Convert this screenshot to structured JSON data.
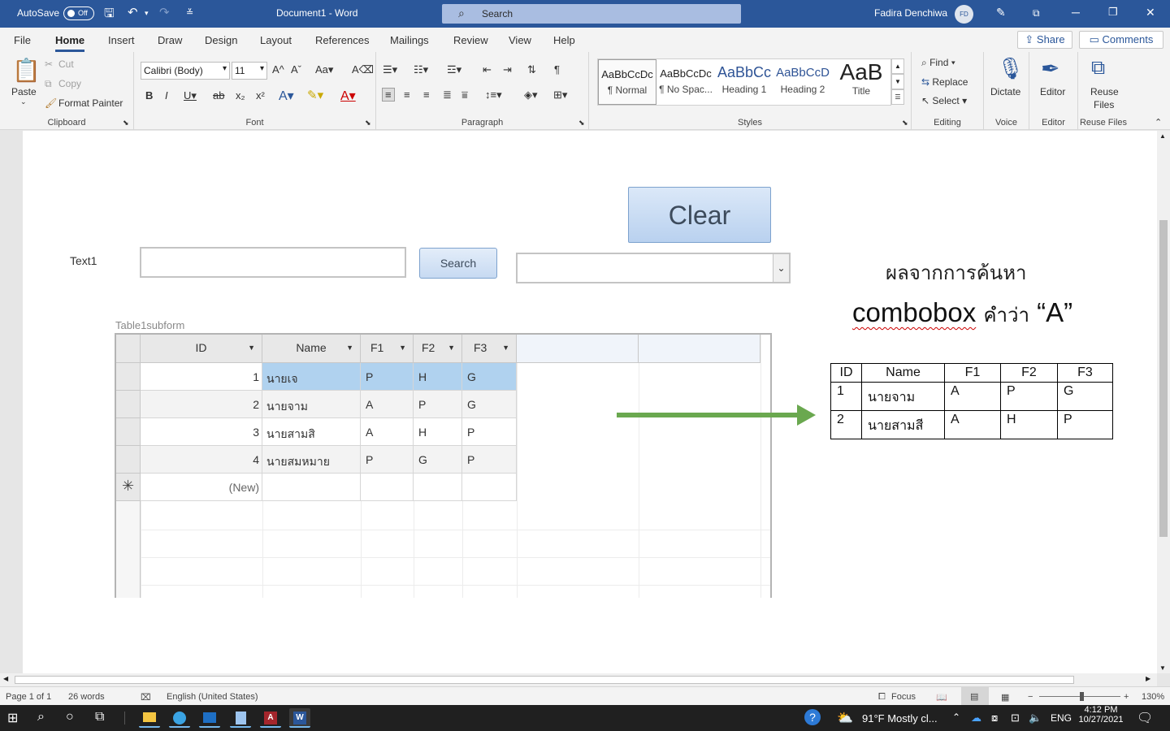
{
  "titlebar": {
    "autosave_label": "AutoSave",
    "autosave_state": "Off",
    "doc_title": "Document1  -  Word",
    "search_placeholder": "Search",
    "user_name": "Fadira Denchiwa",
    "user_initials": "FD"
  },
  "menu": {
    "tabs": [
      "File",
      "Home",
      "Insert",
      "Draw",
      "Design",
      "Layout",
      "References",
      "Mailings",
      "Review",
      "View",
      "Help"
    ],
    "active_tab": "Home",
    "share_label": "Share",
    "comments_label": "Comments"
  },
  "ribbon": {
    "clipboard": {
      "label": "Clipboard",
      "paste": "Paste",
      "cut": "Cut",
      "copy": "Copy",
      "format_painter": "Format Painter"
    },
    "font": {
      "label": "Font",
      "font_name": "Calibri (Body)",
      "font_size": "11"
    },
    "paragraph": {
      "label": "Paragraph"
    },
    "styles": {
      "label": "Styles",
      "items": [
        {
          "preview": "AaBbCcDc",
          "name": "¶ Normal"
        },
        {
          "preview": "AaBbCcDc",
          "name": "¶ No Spac..."
        },
        {
          "preview": "AaBbCc",
          "name": "Heading 1"
        },
        {
          "preview": "AaBbCcD",
          "name": "Heading 2"
        },
        {
          "preview": "AaB",
          "name": "Title"
        }
      ]
    },
    "editing": {
      "label": "Editing",
      "find": "Find",
      "replace": "Replace",
      "select": "Select"
    },
    "voice": {
      "label": "Voice",
      "dictate": "Dictate"
    },
    "editor": {
      "label": "Editor",
      "editor": "Editor"
    },
    "reuse": {
      "label": "Reuse Files",
      "reuse": "Reuse",
      "files": "Files"
    }
  },
  "form": {
    "clear_button": "Clear",
    "text1_label": "Text1",
    "search_button": "Search",
    "subform_caption": "Table1subform",
    "columns": [
      "ID",
      "Name",
      "F1",
      "F2",
      "F3"
    ],
    "rows": [
      {
        "id": "1",
        "name": "นายเจ",
        "f1": "P",
        "f2": "H",
        "f3": "G"
      },
      {
        "id": "2",
        "name": "นายจาม",
        "f1": "A",
        "f2": "P",
        "f3": "G"
      },
      {
        "id": "3",
        "name": "นายสามสิ",
        "f1": "A",
        "f2": "H",
        "f3": "P"
      },
      {
        "id": "4",
        "name": "นายสมหมาย",
        "f1": "P",
        "f2": "G",
        "f3": "P"
      }
    ],
    "new_row": "(New)",
    "new_row_marker": "✳"
  },
  "annotation": {
    "line1": "ผลจากการค้นหา",
    "line2_word": "combobox",
    "line2_thai": "คำว่า",
    "line2_quote": "“A”",
    "table_headers": [
      "ID",
      "Name",
      "F1",
      "F2",
      "F3"
    ],
    "table_rows": [
      [
        "1",
        "นายจาม",
        "A",
        "P",
        "G"
      ],
      [
        "2",
        "นายสามสี",
        "A",
        "H",
        "P"
      ]
    ],
    "arrow_color": "#6aa84f"
  },
  "status": {
    "page": "Page 1 of 1",
    "words": "26 words",
    "language": "English (United States)",
    "focus": "Focus",
    "zoom": "130%"
  },
  "taskbar": {
    "weather": "91°F  Mostly cl...",
    "lang": "ENG",
    "time": "4:12 PM",
    "date": "10/27/2021"
  },
  "colors": {
    "word_blue": "#2b579a",
    "taskbar": "#202020",
    "selection": "#b0d2ef"
  }
}
